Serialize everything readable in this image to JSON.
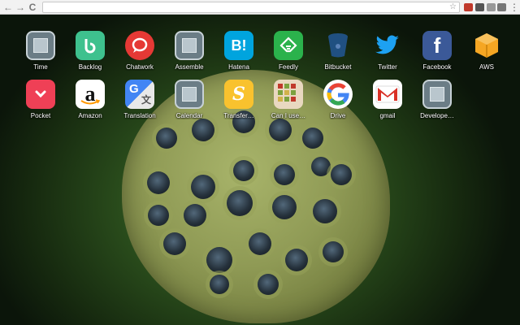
{
  "browser": {
    "address_value": "",
    "address_placeholder": "",
    "back_glyph": "←",
    "forward_glyph": "→",
    "reload_glyph": "C",
    "star_glyph": "☆"
  },
  "apps": [
    {
      "label": "Time",
      "icon": "gray-cube-icon"
    },
    {
      "label": "Backlog",
      "icon": "backlog-icon",
      "color": "#3ec18e"
    },
    {
      "label": "Chatwork",
      "icon": "chatwork-icon",
      "color": "#e53935"
    },
    {
      "label": "Assemble",
      "icon": "gray-cube-icon"
    },
    {
      "label": "Hatena",
      "icon": "hatena-icon",
      "color": "#00a4de",
      "glyph": "B!"
    },
    {
      "label": "Feedly",
      "icon": "feedly-icon",
      "color": "#2bb24c"
    },
    {
      "label": "Bitbucket",
      "icon": "bitbucket-icon",
      "color": "#205081"
    },
    {
      "label": "Twitter",
      "icon": "twitter-icon",
      "color": "#1da1f2"
    },
    {
      "label": "Facebook",
      "icon": "facebook-icon",
      "color": "#3b5998",
      "glyph": "f"
    },
    {
      "label": "AWS",
      "icon": "aws-icon",
      "color": "#f5a623"
    },
    {
      "label": "Pocket",
      "icon": "pocket-icon",
      "color": "#ef4056"
    },
    {
      "label": "Amazon",
      "icon": "amazon-icon",
      "color": "#ffffff",
      "glyph": "a"
    },
    {
      "label": "Translation",
      "icon": "translate-icon",
      "color": "#4285f4",
      "glyph": "G"
    },
    {
      "label": "Calendar",
      "icon": "gray-cube-icon"
    },
    {
      "label": "Transfer…",
      "icon": "transfer-icon",
      "color": "#f9c22e",
      "glyph": "S"
    },
    {
      "label": "Can I use…",
      "icon": "caniuse-icon",
      "color": "#e9d8c0"
    },
    {
      "label": "Drive",
      "icon": "google-icon",
      "color": "#ffffff",
      "glyph": "G"
    },
    {
      "label": "gmail",
      "icon": "gmail-icon",
      "color": "#ffffff",
      "glyph": "M"
    },
    {
      "label": "Develope…",
      "icon": "gray-cube-icon"
    }
  ]
}
